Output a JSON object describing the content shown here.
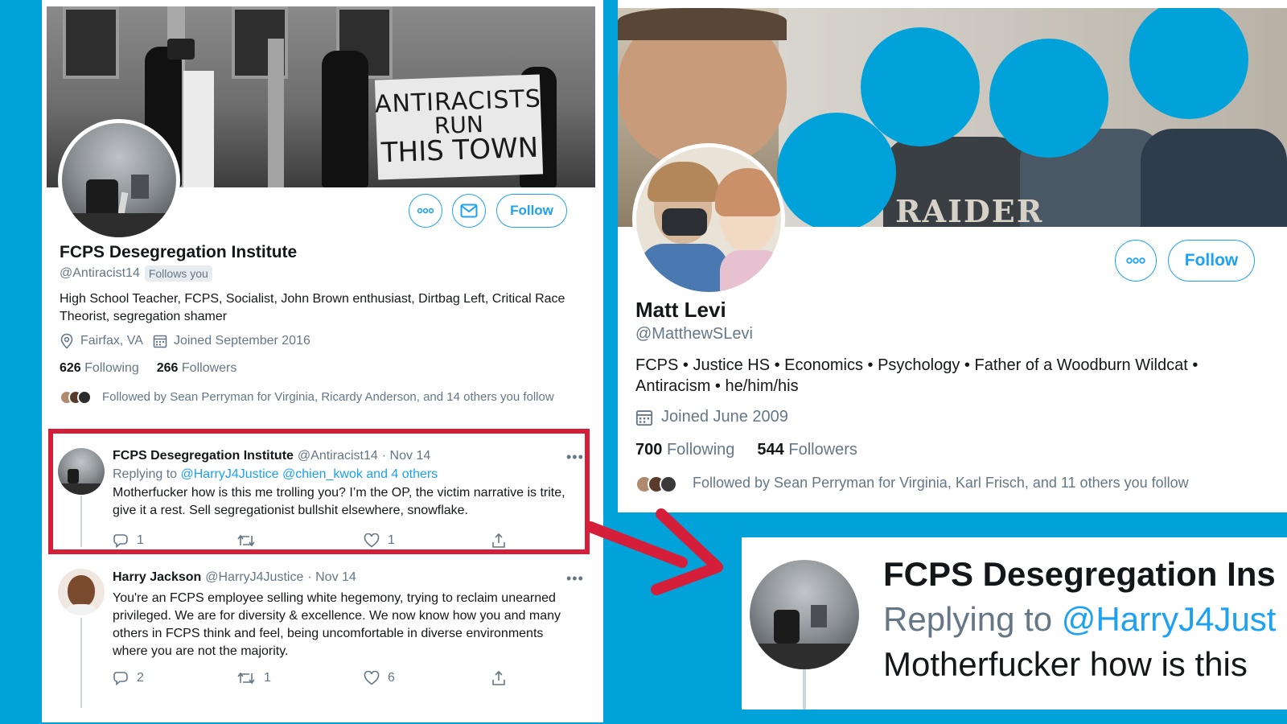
{
  "colors": {
    "background": "#00a2d9",
    "twitter_blue": "#1da1f2",
    "highlight_red": "#d51f3a",
    "secondary_text": "#657786"
  },
  "left_profile": {
    "banner_sign": {
      "line1": "ANTIRACISTS",
      "line2": "RUN",
      "line3": "THIS TOWN"
    },
    "more_icon": "more-icon",
    "message_icon": "envelope-icon",
    "follow_label": "Follow",
    "name": "FCPS Desegregation Institute",
    "handle": "@Antiracist14",
    "follows_you": "Follows you",
    "bio": "High School Teacher, FCPS, Socialist, John Brown enthusiast, Dirtbag Left, Critical Race Theorist, segregation shamer",
    "location": "Fairfax, VA",
    "joined": "Joined September 2016",
    "following_count": "626",
    "following_label": "Following",
    "followers_count": "266",
    "followers_label": "Followers",
    "followed_by": "Followed by Sean Perryman for Virginia, Ricardy Anderson, and 14 others you follow"
  },
  "tweets": [
    {
      "name": "FCPS Desegregation Institute",
      "handle": "@Antiracist14",
      "date": "· Nov 14",
      "replying_prefix": "Replying to",
      "replying_to": "@HarryJ4Justice @chien_kwok and 4 others",
      "text": "Motherfucker how is this me trolling you? I’m the OP, the victim narrative is trite, give it a rest. Sell segregationist bullshit elsewhere, snowflake.",
      "replies": "1",
      "retweets": "",
      "likes": "1",
      "more": "•••"
    },
    {
      "name": "Harry Jackson",
      "handle": "@HarryJ4Justice",
      "date": "· Nov 14",
      "text": "You're an FCPS employee selling white hegemony, trying to reclaim unearned privileged. We are for diversity & excellence. We now know how you and many others in FCPS think and feel, being uncomfortable in diverse environments where you are not the majority.",
      "replies": "2",
      "retweets": "1",
      "likes": "6",
      "more": "•••"
    }
  ],
  "right_profile": {
    "banner_text": "RAIDER",
    "follow_label": "Follow",
    "name": "Matt Levi",
    "handle": "@MatthewSLevi",
    "bio": "FCPS • Justice HS • Economics • Psychology • Father of a Woodburn Wildcat • Antiracism • he/him/his",
    "joined": "Joined June 2009",
    "following_count": "700",
    "following_label": "Following",
    "followers_count": "544",
    "followers_label": "Followers",
    "followed_by": "Followed by Sean Perryman for Virginia, Karl Frisch, and 11 others you follow"
  },
  "zoom": {
    "name": "FCPS Desegregation Ins",
    "replying_prefix": "Replying to",
    "replying_to": "@HarryJ4Just",
    "text": "Motherfucker how is this"
  }
}
